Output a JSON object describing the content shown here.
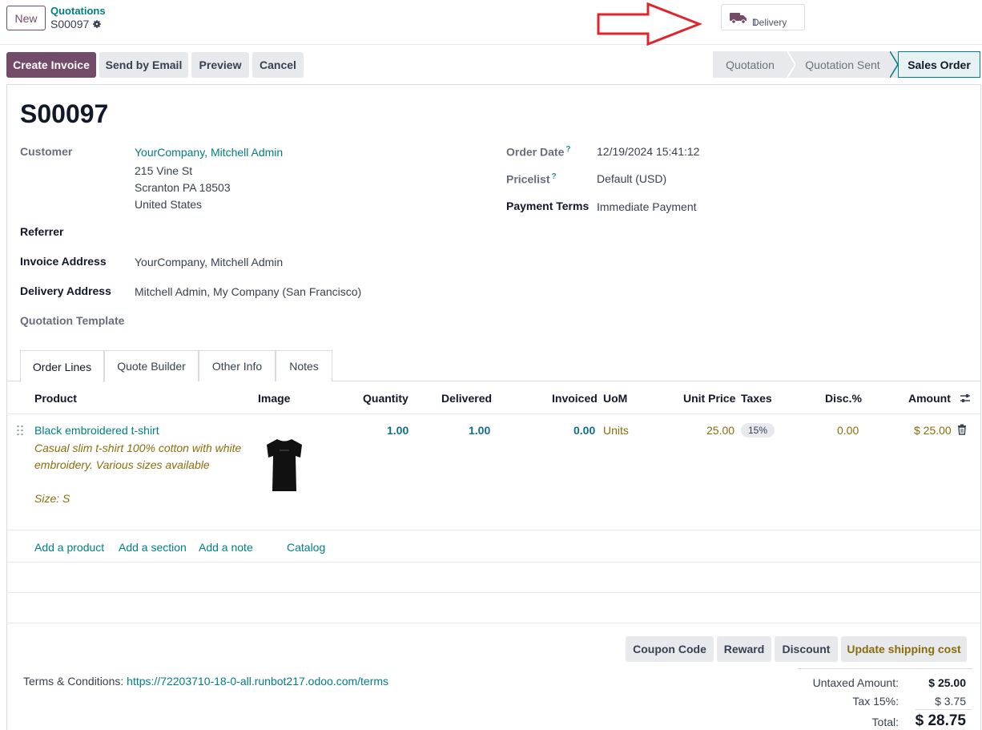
{
  "header": {
    "new_label": "New",
    "breadcrumb_parent": "Quotations",
    "breadcrumb_current": "S00097",
    "delivery_label": "Delivery",
    "delivery_count": "1"
  },
  "actions": {
    "create_invoice": "Create Invoice",
    "send_email": "Send by Email",
    "preview": "Preview",
    "cancel": "Cancel"
  },
  "status": {
    "stages": [
      "Quotation",
      "Quotation Sent",
      "Sales Order"
    ],
    "active": "Sales Order"
  },
  "form": {
    "title": "S00097",
    "customer_label": "Customer",
    "customer_name": "YourCompany, Mitchell Admin",
    "address_line1": "215 Vine St",
    "address_line2": "Scranton PA 18503",
    "address_line3": "United States",
    "referrer_label": "Referrer",
    "invoice_address_label": "Invoice Address",
    "invoice_address": "YourCompany, Mitchell Admin",
    "delivery_address_label": "Delivery Address",
    "delivery_address": "Mitchell Admin, My Company (San Francisco)",
    "quotation_template_label": "Quotation Template",
    "order_date_label": "Order Date",
    "order_date": "12/19/2024 15:41:12",
    "pricelist_label": "Pricelist",
    "pricelist": "Default (USD)",
    "payment_terms_label": "Payment Terms",
    "payment_terms": "Immediate Payment",
    "help_mark": "?"
  },
  "tabs": [
    "Order Lines",
    "Quote Builder",
    "Other Info",
    "Notes"
  ],
  "table": {
    "headers": {
      "product": "Product",
      "image": "Image",
      "quantity": "Quantity",
      "delivered": "Delivered",
      "invoiced": "Invoiced",
      "uom": "UoM",
      "unit_price": "Unit Price",
      "taxes": "Taxes",
      "disc": "Disc.%",
      "amount": "Amount"
    },
    "rows": [
      {
        "product": "Black embroidered t-shirt",
        "desc_line1": "Casual slim t-shirt 100% cotton with white",
        "desc_line2": "embroidery. Various sizes available",
        "desc_line3": "Size: S",
        "quantity": "1.00",
        "delivered": "1.00",
        "invoiced": "0.00",
        "uom": "Units",
        "unit_price": "25.00",
        "tax": "15%",
        "disc": "0.00",
        "amount": "$ 25.00"
      }
    ],
    "add_product": "Add a product",
    "add_section": "Add a section",
    "add_note": "Add a note",
    "catalog": "Catalog"
  },
  "footer_buttons": {
    "coupon": "Coupon Code",
    "reward": "Reward",
    "discount": "Discount",
    "shipping": "Update shipping cost"
  },
  "terms": {
    "label": "Terms & Conditions:",
    "url": "https://72203710-18-0-all.runbot217.odoo.com/terms"
  },
  "totals": {
    "untaxed_label": "Untaxed Amount:",
    "untaxed": "$ 25.00",
    "tax_label": "Tax 15%:",
    "tax": "$ 3.75",
    "total_label": "Total:",
    "total": "$ 28.75"
  },
  "colors": {
    "primary": "#714b67",
    "link": "#017e84",
    "annotation_arrow": "#e0242b"
  }
}
